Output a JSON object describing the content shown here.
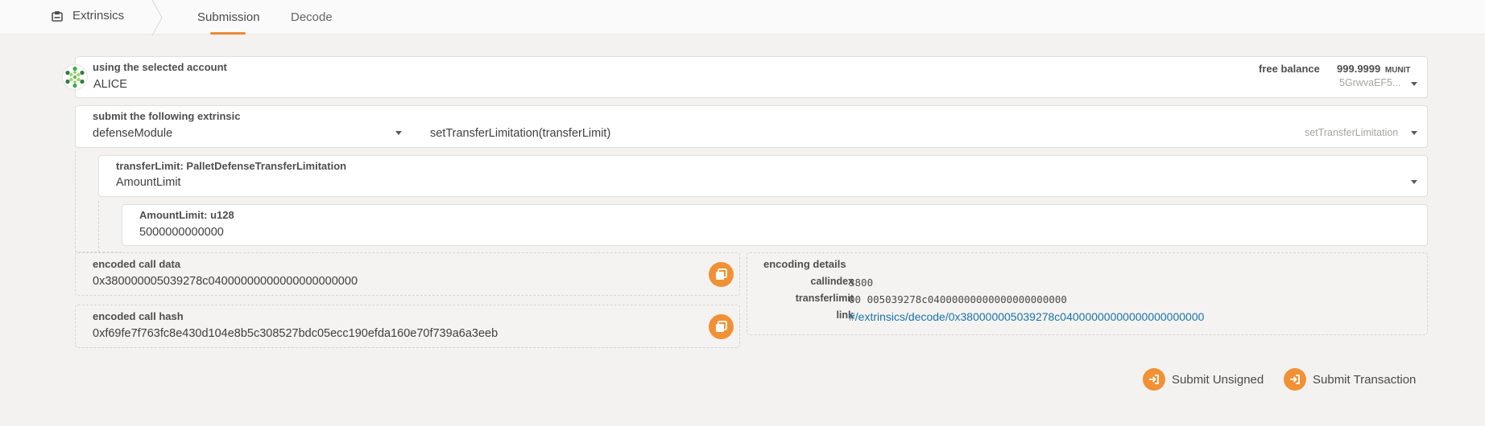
{
  "header": {
    "app_title": "Extrinsics",
    "tabs": [
      {
        "label": "Submission",
        "active": true
      },
      {
        "label": "Decode",
        "active": false
      }
    ],
    "icons": {
      "app": "extrinsics-icon"
    }
  },
  "account": {
    "label": "using the selected account",
    "value": "ALICE",
    "free_balance_label": "free balance",
    "balance_int": "999.",
    "balance_dec": "9999",
    "balance_unit": "MUNIT",
    "address": "5GrwvaEF5..."
  },
  "extrinsic": {
    "label": "submit the following extrinsic",
    "module": "defenseModule",
    "call": "setTransferLimitation(transferLimit)",
    "call_short": "setTransferLimitation"
  },
  "param": {
    "label": "transferLimit: PalletDefenseTransferLimitation",
    "value": "AmountLimit"
  },
  "subparam": {
    "label": "AmountLimit: u128",
    "value": "5000000000000"
  },
  "encoded_call_data": {
    "label": "encoded call data",
    "value": "0x380000005039278c04000000000000000000000"
  },
  "encoded_call_hash": {
    "label": "encoded call hash",
    "value": "0xf69fe7f763fc8e430d104e8b5c308527bdc05ecc190efda160e70f739a6a3eeb"
  },
  "encoding_details": {
    "title": "encoding details",
    "callindex_label": "callindex",
    "callindex_value": "3800",
    "transferlimit_label": "transferlimit",
    "transferlimit_value": "00 005039278c04000000000000000000000",
    "link_label": "link",
    "link_value": "#/extrinsics/decode/0x380000005039278c04000000000000000000000"
  },
  "actions": {
    "submit_unsigned": "Submit Unsigned",
    "submit_transaction": "Submit Transaction"
  },
  "colors": {
    "accent": "#f19135",
    "link": "#1a73a8"
  }
}
